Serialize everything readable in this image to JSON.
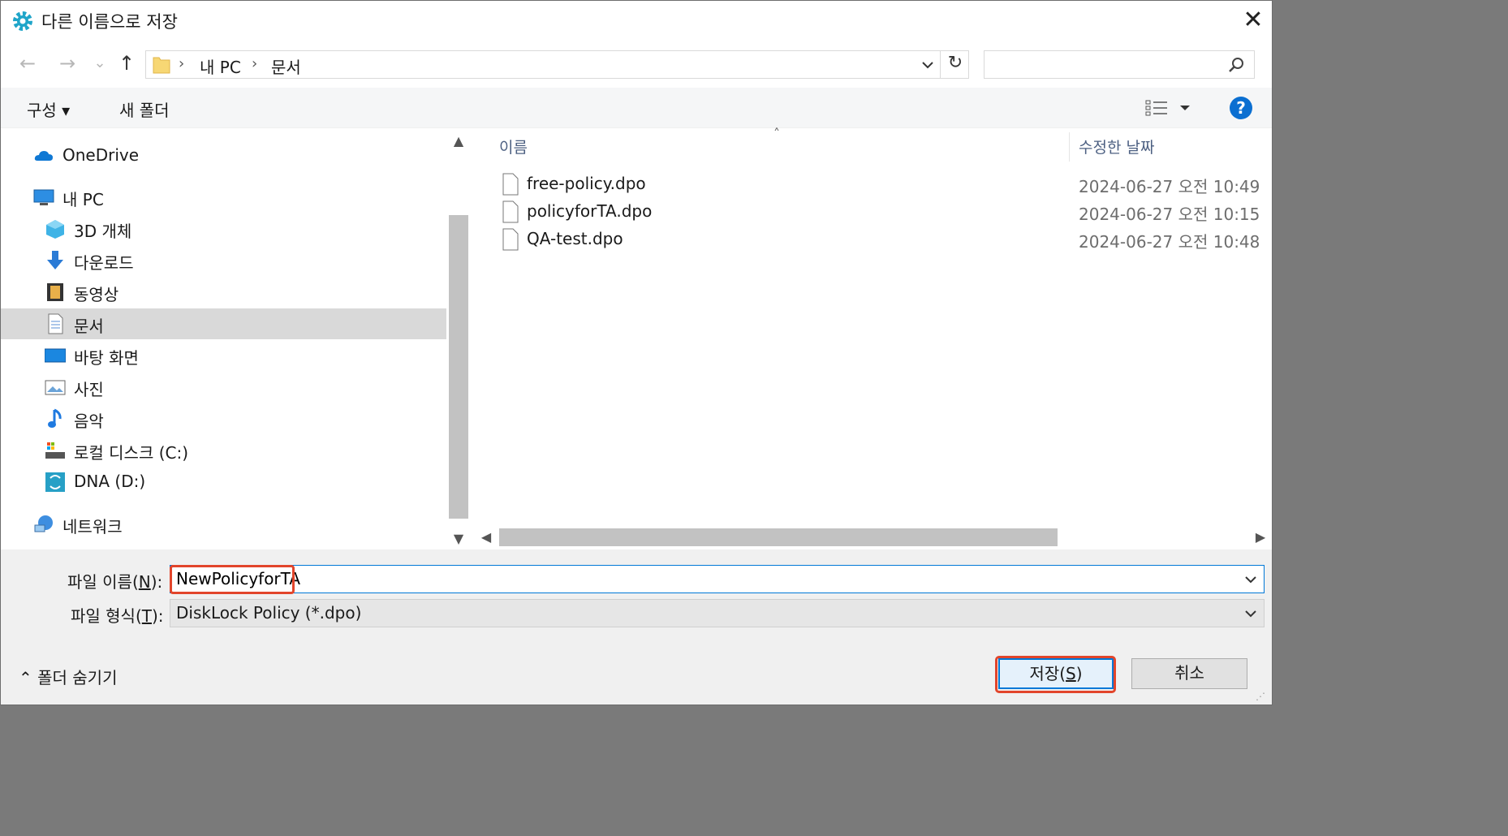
{
  "window": {
    "title": "다른 이름으로 저장",
    "close_glyph": "✕"
  },
  "address": {
    "crumbs": [
      "내 PC",
      "문서"
    ],
    "separator": "›",
    "search_placeholder": ""
  },
  "nav_buttons": {
    "back": "←",
    "forward": "→",
    "recent": "⌄",
    "up": "↑",
    "refresh": "↻"
  },
  "commands": {
    "organize": "구성 ▾",
    "new_folder": "새 폴더",
    "help": "?"
  },
  "sidebar": {
    "items": [
      {
        "label": "OneDrive",
        "icon": "onedrive-icon"
      },
      {
        "label": "내 PC",
        "icon": "pc-icon"
      },
      {
        "label": "3D 개체",
        "icon": "3d-objects-icon"
      },
      {
        "label": "다운로드",
        "icon": "download-icon"
      },
      {
        "label": "동영상",
        "icon": "video-icon"
      },
      {
        "label": "문서",
        "icon": "document-icon",
        "selected": true
      },
      {
        "label": "바탕 화면",
        "icon": "desktop-icon"
      },
      {
        "label": "사진",
        "icon": "pictures-icon"
      },
      {
        "label": "음악",
        "icon": "music-icon"
      },
      {
        "label": "로컬 디스크 (C:)",
        "icon": "drive-icon"
      },
      {
        "label": "DNA (D:)",
        "icon": "dna-drive-icon"
      },
      {
        "label": "네트워크",
        "icon": "network-icon"
      }
    ]
  },
  "file_list": {
    "columns": {
      "name": "이름",
      "modified": "수정한 날짜"
    },
    "files": [
      {
        "name": "free-policy.dpo",
        "modified": "2024-06-27 오전 10:49"
      },
      {
        "name": "policyforTA.dpo",
        "modified": "2024-06-27 오전 10:15"
      },
      {
        "name": "QA-test.dpo",
        "modified": "2024-06-27 오전 10:48"
      }
    ]
  },
  "form": {
    "filename_label": "파일 이름",
    "filename_key": "N",
    "filename_value": "NewPolicyforTA",
    "filetype_label": "파일 형식",
    "filetype_key": "T",
    "filetype_value": "DiskLock Policy (*.dpo)"
  },
  "footer": {
    "hide_folders": "⌃ 폴더 숨기기",
    "save_label": "저장",
    "save_key": "S",
    "cancel_label": "취소"
  },
  "colors": {
    "accent": "#0078d7",
    "highlight": "#e2452b",
    "selected_row": "#d9d9d9",
    "help_blue": "#0b6fd1"
  }
}
